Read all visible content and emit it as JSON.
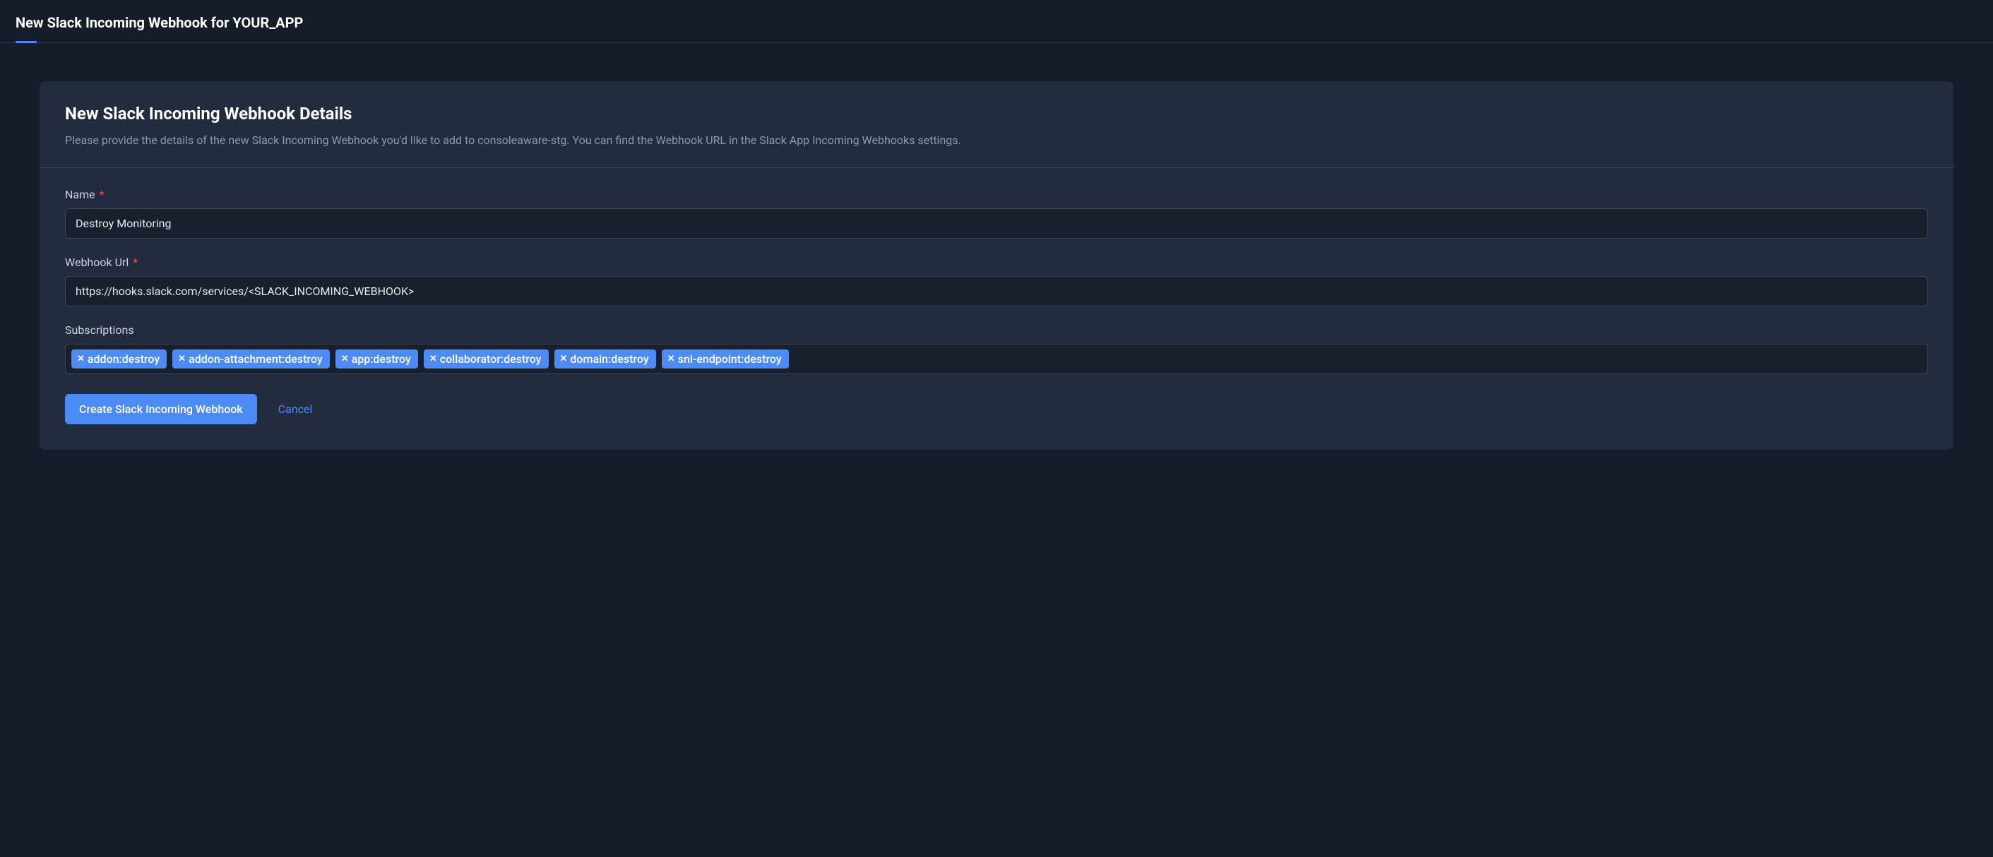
{
  "header": {
    "title": "New Slack Incoming Webhook for YOUR_APP"
  },
  "card": {
    "title": "New Slack Incoming Webhook Details",
    "subtitle": "Please provide the details of the new Slack Incoming Webhook you'd like to add to consoleaware-stg. You can find the Webhook URL in the Slack App Incoming Webhooks settings."
  },
  "form": {
    "name": {
      "label": "Name",
      "value": "Destroy Monitoring",
      "required": true
    },
    "webhook_url": {
      "label": "Webhook Url",
      "value": "https://hooks.slack.com/services/<SLACK_INCOMING_WEBHOOK>",
      "required": true
    },
    "subscriptions": {
      "label": "Subscriptions",
      "tags": [
        "addon:destroy",
        "addon-attachment:destroy",
        "app:destroy",
        "collaborator:destroy",
        "domain:destroy",
        "sni-endpoint:destroy"
      ]
    },
    "actions": {
      "submit_label": "Create Slack Incoming Webhook",
      "cancel_label": "Cancel"
    }
  },
  "required_marker": "*"
}
